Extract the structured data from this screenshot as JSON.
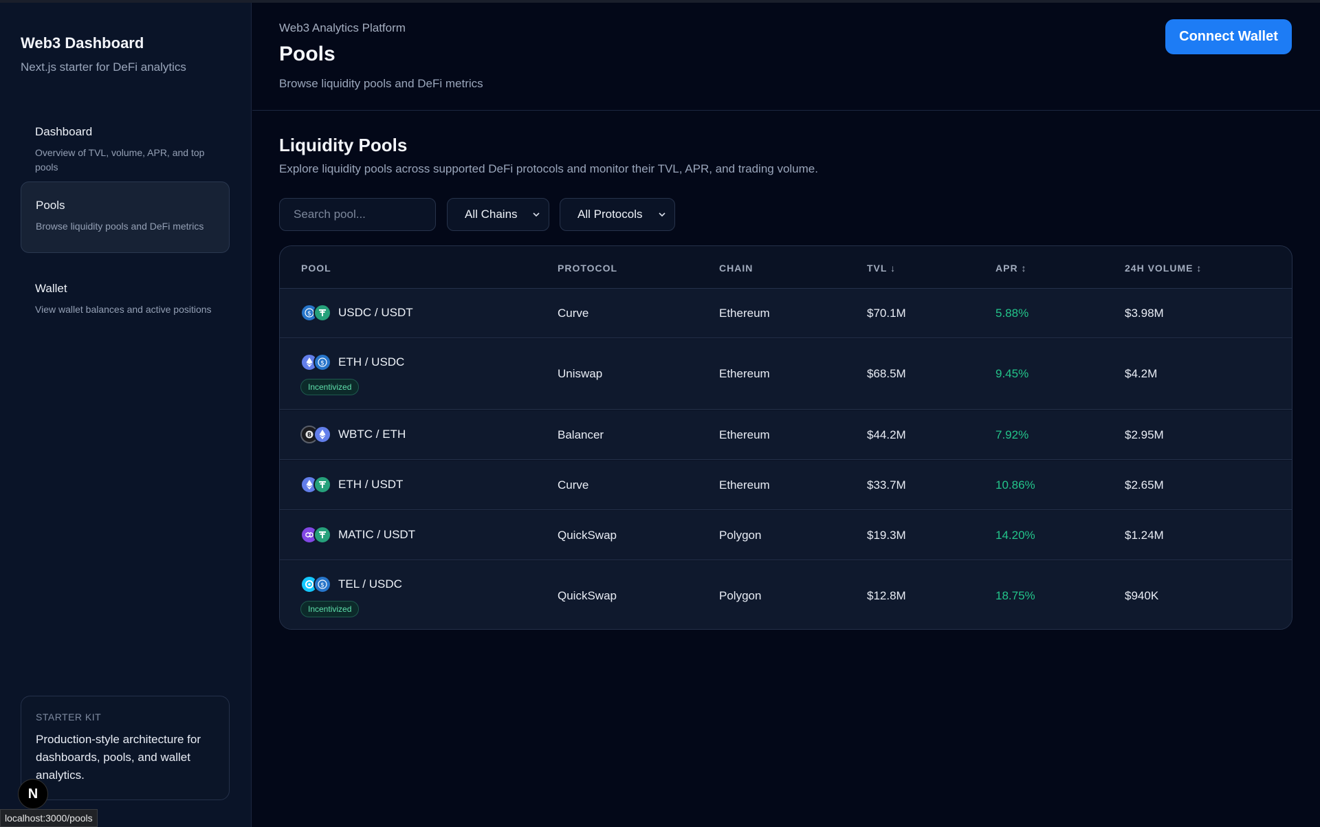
{
  "sidebar": {
    "title": "Web3 Dashboard",
    "subtitle": "Next.js starter for DeFi analytics",
    "items": [
      {
        "label": "Dashboard",
        "desc": "Overview of TVL, volume, APR, and top pools"
      },
      {
        "label": "Pools",
        "desc": "Browse liquidity pools and DeFi metrics"
      },
      {
        "label": "Wallet",
        "desc": "View wallet balances and active positions"
      }
    ],
    "starter": {
      "label": "STARTER KIT",
      "text": "Production-style architecture for dashboards, pools, and wallet analytics."
    }
  },
  "header": {
    "eyebrow": "Web3 Analytics Platform",
    "title": "Pools",
    "subtitle": "Browse liquidity pools and DeFi metrics",
    "connect_label": "Connect Wallet"
  },
  "main": {
    "title": "Liquidity Pools",
    "subtitle": "Explore liquidity pools across supported DeFi protocols and monitor their TVL, APR, and trading volume.",
    "search_placeholder": "Search pool...",
    "chain_filter": "All Chains",
    "protocol_filter": "All Protocols"
  },
  "table": {
    "columns": [
      "POOL",
      "PROTOCOL",
      "CHAIN",
      "TVL ↓",
      "APR ↕",
      "24H VOLUME ↕"
    ],
    "rows": [
      {
        "pair": "USDC / USDT",
        "protocol": "Curve",
        "chain": "Ethereum",
        "tvl": "$70.1M",
        "apr": "5.88%",
        "volume": "$3.98M",
        "badge": ""
      },
      {
        "pair": "ETH / USDC",
        "protocol": "Uniswap",
        "chain": "Ethereum",
        "tvl": "$68.5M",
        "apr": "9.45%",
        "volume": "$4.2M",
        "badge": "Incentivized"
      },
      {
        "pair": "WBTC / ETH",
        "protocol": "Balancer",
        "chain": "Ethereum",
        "tvl": "$44.2M",
        "apr": "7.92%",
        "volume": "$2.95M",
        "badge": ""
      },
      {
        "pair": "ETH / USDT",
        "protocol": "Curve",
        "chain": "Ethereum",
        "tvl": "$33.7M",
        "apr": "10.86%",
        "volume": "$2.65M",
        "badge": ""
      },
      {
        "pair": "MATIC / USDT",
        "protocol": "QuickSwap",
        "chain": "Polygon",
        "tvl": "$19.3M",
        "apr": "14.20%",
        "volume": "$1.24M",
        "badge": ""
      },
      {
        "pair": "TEL / USDC",
        "protocol": "QuickSwap",
        "chain": "Polygon",
        "tvl": "$12.8M",
        "apr": "18.75%",
        "volume": "$940K",
        "badge": "Incentivized"
      }
    ]
  },
  "overlay": {
    "n_badge": "N",
    "status_url": "localhost:3000/pools"
  },
  "colors": {
    "accent": "#1d7cf5",
    "apr_green": "#23c48a",
    "background": "#030818",
    "sidebar": "#0a1428"
  },
  "icons": {
    "usdc": "usdc-icon",
    "usdt": "usdt-icon",
    "eth": "eth-icon",
    "wbtc": "btc-icon",
    "matic": "matic-icon",
    "tel": "tel-icon"
  }
}
